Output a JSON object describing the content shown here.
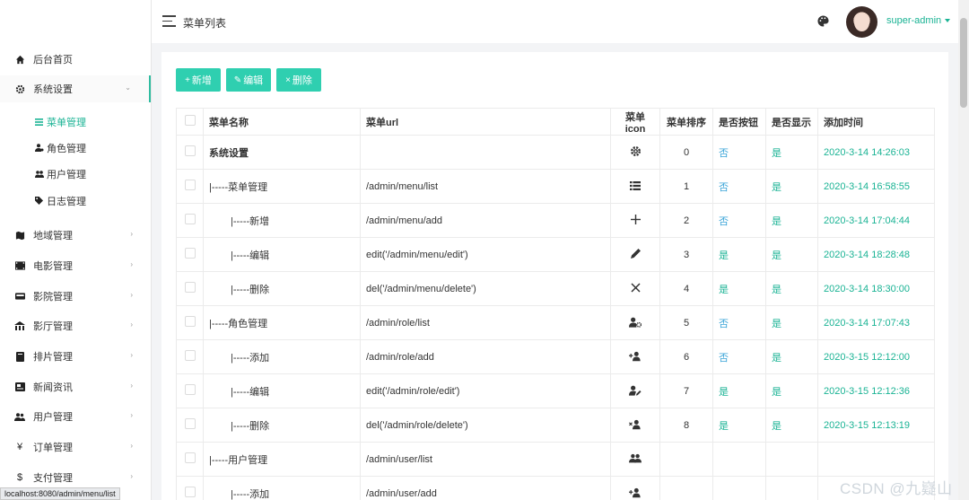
{
  "header": {
    "title": "菜单列表",
    "user": "super-admin"
  },
  "sidebar": {
    "items": [
      {
        "label": "后台首页",
        "icon": "home-icon"
      },
      {
        "label": "系统设置",
        "icon": "gear-icon"
      },
      {
        "label": "地域管理",
        "icon": "map-icon"
      },
      {
        "label": "电影管理",
        "icon": "film-icon"
      },
      {
        "label": "影院管理",
        "icon": "cinema-icon"
      },
      {
        "label": "影厅管理",
        "icon": "hall-icon"
      },
      {
        "label": "排片管理",
        "icon": "schedule-icon"
      },
      {
        "label": "新闻资讯",
        "icon": "news-icon"
      },
      {
        "label": "用户管理",
        "icon": "users-icon"
      },
      {
        "label": "订单管理",
        "icon": "yen-icon"
      },
      {
        "label": "支付管理",
        "icon": "dollar-icon"
      }
    ],
    "sub_items": [
      {
        "label": "菜单管理",
        "icon": "list-icon"
      },
      {
        "label": "角色管理",
        "icon": "user-gear-icon"
      },
      {
        "label": "用户管理",
        "icon": "users-icon"
      },
      {
        "label": "日志管理",
        "icon": "tag-icon"
      }
    ]
  },
  "toolbar": {
    "add": "新增",
    "edit": "编辑",
    "delete": "删除"
  },
  "table": {
    "headers": [
      "菜单名称",
      "菜单url",
      "菜单icon",
      "菜单排序",
      "是否按钮",
      "是否显示",
      "添加时间"
    ],
    "rows": [
      {
        "name": "系统设置",
        "url": "",
        "icon": "gear-icon",
        "order": "0",
        "button": "否",
        "show": "是",
        "time": "2020-3-14 14:26:03"
      },
      {
        "name": "|-----菜单管理",
        "url": "/admin/menu/list",
        "icon": "list-icon",
        "order": "1",
        "button": "否",
        "show": "是",
        "time": "2020-3-14 16:58:55"
      },
      {
        "name": "|-----新增",
        "url": "/admin/menu/add",
        "icon": "plus-icon",
        "order": "2",
        "button": "否",
        "show": "是",
        "time": "2020-3-14 17:04:44"
      },
      {
        "name": "|-----编辑",
        "url": "edit('/admin/menu/edit')",
        "icon": "pencil-icon",
        "order": "3",
        "button": "是",
        "show": "是",
        "time": "2020-3-14 18:28:48"
      },
      {
        "name": "|-----删除",
        "url": "del('/admin/menu/delete')",
        "icon": "close-icon",
        "order": "4",
        "button": "是",
        "show": "是",
        "time": "2020-3-14 18:30:00"
      },
      {
        "name": "|-----角色管理",
        "url": "/admin/role/list",
        "icon": "user-gear-icon",
        "order": "5",
        "button": "否",
        "show": "是",
        "time": "2020-3-14 17:07:43"
      },
      {
        "name": "|-----添加",
        "url": "/admin/role/add",
        "icon": "user-plus-icon",
        "order": "6",
        "button": "否",
        "show": "是",
        "time": "2020-3-15 12:12:00"
      },
      {
        "name": "|-----编辑",
        "url": "edit('/admin/role/edit')",
        "icon": "user-edit-icon",
        "order": "7",
        "button": "是",
        "show": "是",
        "time": "2020-3-15 12:12:36"
      },
      {
        "name": "|-----删除",
        "url": "del('/admin/role/delete')",
        "icon": "user-times-icon",
        "order": "8",
        "button": "是",
        "show": "是",
        "time": "2020-3-15 12:13:19"
      },
      {
        "name": "|-----用户管理",
        "url": "/admin/user/list",
        "icon": "users-icon",
        "order": "",
        "button": "",
        "show": "",
        "time": ""
      },
      {
        "name": "|-----添加",
        "url": "/admin/user/add",
        "icon": "user-plus-icon",
        "order": "",
        "button": "",
        "show": "",
        "time": ""
      }
    ]
  },
  "status_url": "localhost:8080/admin/menu/list",
  "watermark": "CSDN @九嶷山",
  "colors": {
    "accent": "#1ab394",
    "button": "#2fcfb0",
    "no": "#3ba5d8"
  }
}
